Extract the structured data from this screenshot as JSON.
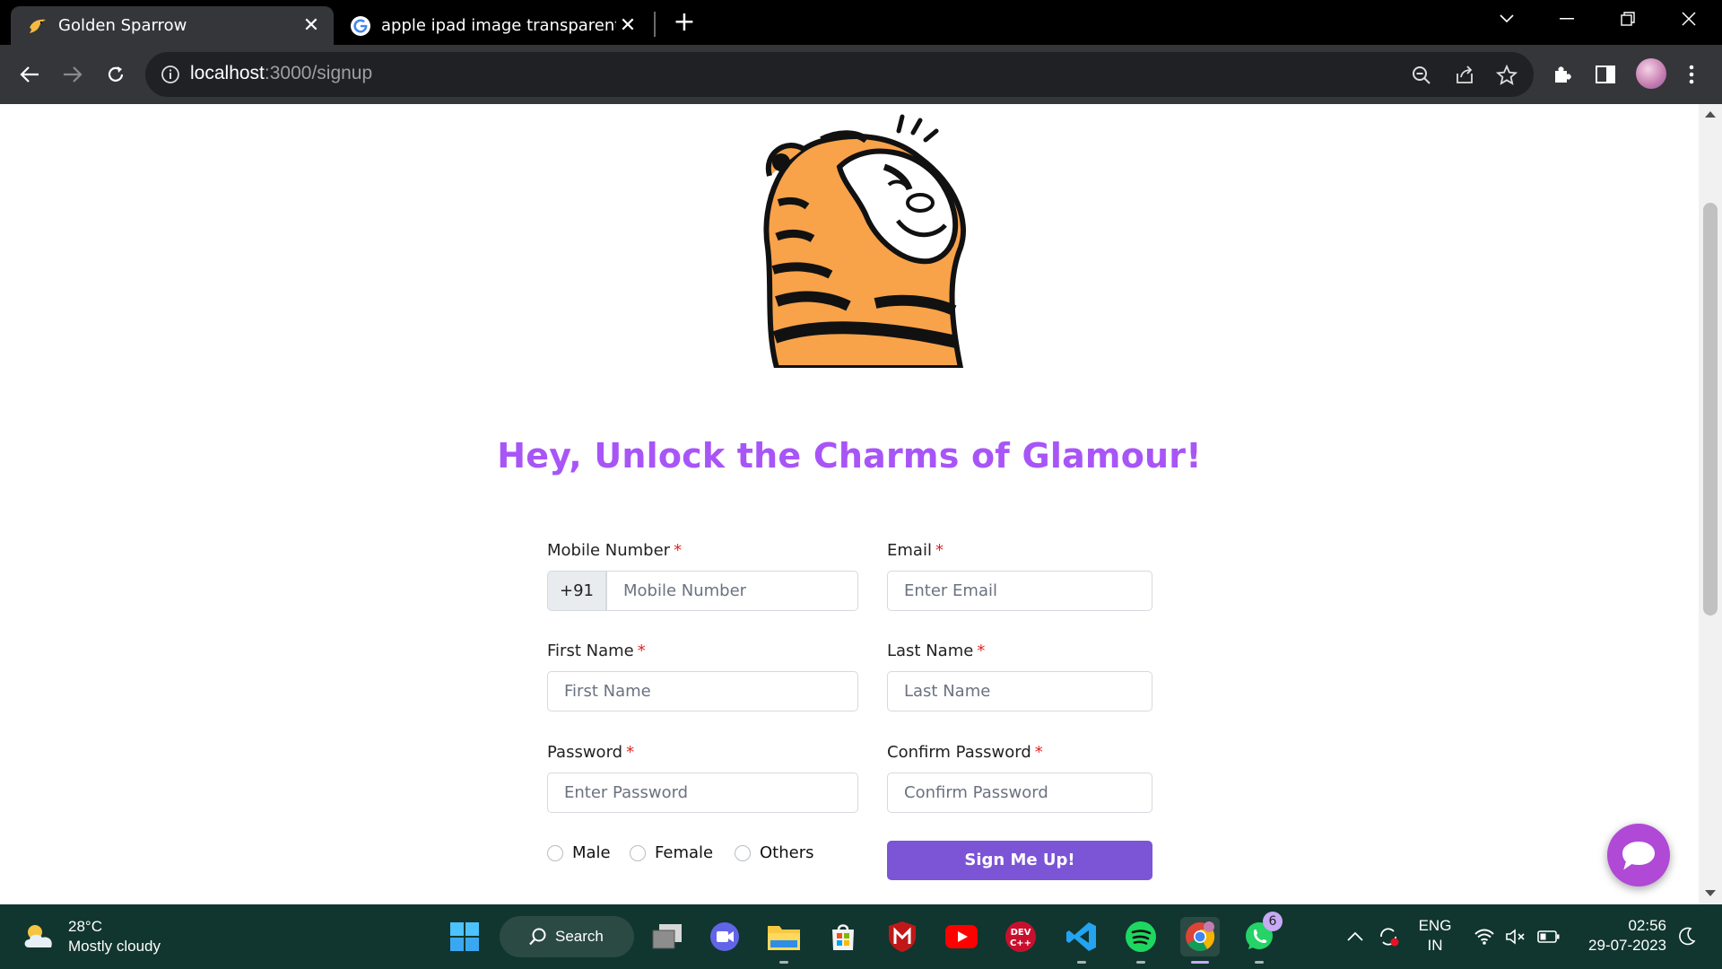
{
  "browser": {
    "tabs": [
      {
        "title": "Golden Sparrow",
        "icon": "golden-sparrow-favicon",
        "active": true
      },
      {
        "title": "apple ipad image transparent ba",
        "icon": "google-favicon",
        "active": false
      }
    ],
    "url_host": "localhost",
    "url_rest": ":3000/signup",
    "colors": {
      "titlebar": "#000000",
      "toolbar": "#35363a",
      "omnibox": "#202124"
    }
  },
  "page": {
    "headline": "Hey, Unlock the Charms of Glamour!",
    "headline_color": "#a855f7",
    "mascot": "tiger-illustration",
    "form": {
      "mobile_label": "Mobile Number",
      "country_code": "+91",
      "mobile_placeholder": "Mobile Number",
      "email_label": "Email",
      "email_placeholder": "Enter Email",
      "first_name_label": "First Name",
      "first_name_placeholder": "First Name",
      "last_name_label": "Last Name",
      "last_name_placeholder": "Last Name",
      "password_label": "Password",
      "password_placeholder": "Enter Password",
      "confirm_label": "Confirm Password",
      "confirm_placeholder": "Confirm Password",
      "required_mark": "*",
      "gender_options": [
        "Male",
        "Female",
        "Others"
      ],
      "submit_label": "Sign Me Up!",
      "submit_color": "#7c55d6"
    },
    "chat_button_color": "#b049d6"
  },
  "taskbar": {
    "weather_temp": "28°C",
    "weather_desc": "Mostly cloudy",
    "search_label": "Search",
    "whatsapp_badge": "6",
    "lang_line1": "ENG",
    "lang_line2": "IN",
    "time": "02:56",
    "date": "29-07-2023",
    "background": "#10362f"
  }
}
